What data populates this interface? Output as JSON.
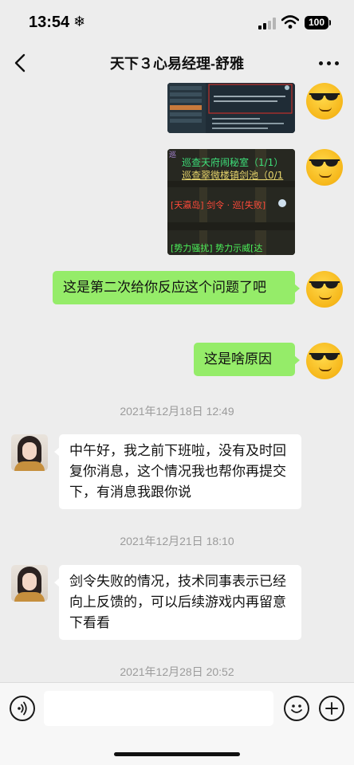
{
  "status": {
    "time": "13:54",
    "weather_glyph": "❄",
    "battery": "100"
  },
  "header": {
    "title": "天下３心易经理-舒雅"
  },
  "messages": {
    "m1_image": {
      "lines": []
    },
    "m2_image": {
      "lines": [
        "巡查天府闹秘室（1/1）",
        "巡查翠微楼镇剑池（0/1",
        "[天瀛岛] 剑令 · 巡[失败]",
        "[势力骚扰] 势力示威[达"
      ]
    },
    "m3": "这是第二次给你反应这个问题了吧",
    "m4": "这是啥原因",
    "ts1": "2021年12月18日 12:49",
    "m5": "中午好，我之前下班啦，没有及时回复你消息，这个情况我也帮你再提交下，有消息我跟你说",
    "ts2": "2021年12月21日 18:10",
    "m6": "剑令失败的情况，技术同事表示已经向上反馈的，可以后续游戏内再留意下看看",
    "ts3": "2021年12月28日 20:52"
  },
  "input": {
    "placeholder": "",
    "value": ""
  },
  "colors": {
    "outgoing_bubble": "#95ec69",
    "incoming_bubble": "#ffffff",
    "background": "#ededed"
  },
  "icons": [
    "back-arrow-icon",
    "more-icon",
    "voice-icon",
    "emoji-icon",
    "plus-icon",
    "cool-emoji-avatar"
  ]
}
